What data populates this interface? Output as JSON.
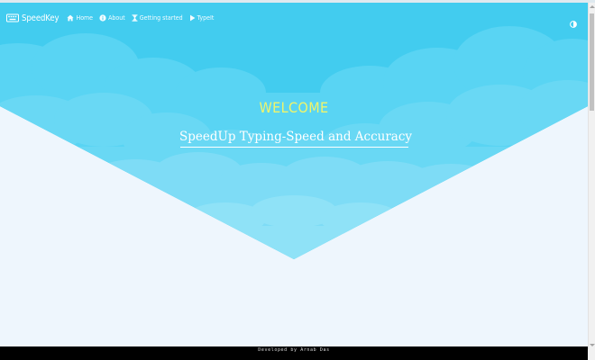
{
  "brand": {
    "name": "SpeedKey",
    "icon": "keyboard-icon"
  },
  "nav": [
    {
      "label": "Home",
      "icon": "home-icon"
    },
    {
      "label": "About",
      "icon": "info-icon"
    },
    {
      "label": "Getting started",
      "icon": "hourglass-icon"
    },
    {
      "label": "TypeIt",
      "icon": "play-icon"
    }
  ],
  "theme_toggle": {
    "icon": "contrast-icon"
  },
  "hero": {
    "heading": "WELCOME",
    "tagline": "SpeedUp Typing-Speed and Accuracy",
    "tagline_icon": "rocket-icon"
  },
  "footer": {
    "text": "Developed by Arnab Das"
  },
  "colors": {
    "sky": "#45cdf0",
    "cloud_light": "#7fdcf6",
    "heading": "#f0f56a",
    "page_background": "#eef6fd",
    "footer_background": "#000000"
  }
}
